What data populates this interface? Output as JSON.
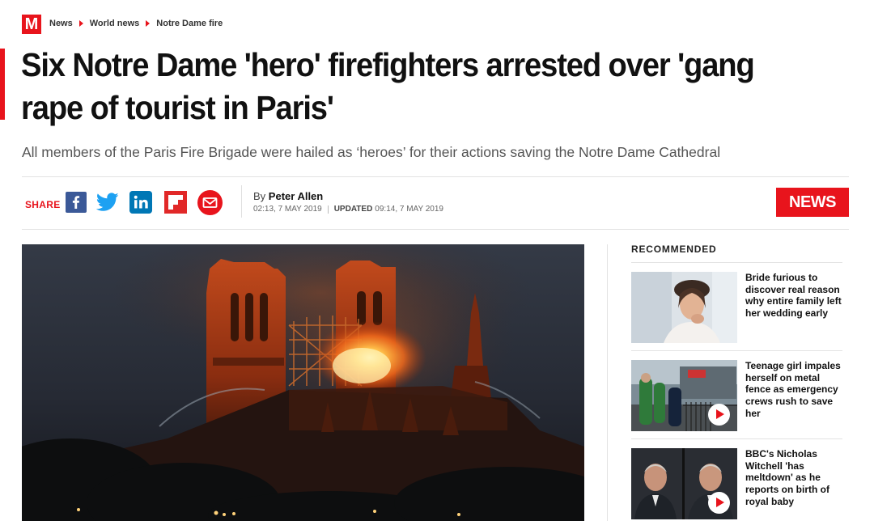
{
  "site": {
    "logo_letter": "M",
    "brand_color": "#e8141c"
  },
  "breadcrumb": [
    "News",
    "World news",
    "Notre Dame fire"
  ],
  "article": {
    "headline": "Six Notre Dame 'hero' firefighters arrested over 'gang rape of tourist in Paris'",
    "standfirst": "All members of the Paris Fire Brigade were hailed as ‘heroes’ for their actions saving the Notre Dame Cathedral",
    "by_prefix": "By",
    "author": "Peter Allen",
    "published": "02:13, 7 MAY 2019",
    "updated_label": "UPDATED",
    "updated": "09:14, 7 MAY 2019",
    "section_tag": "NEWS"
  },
  "share": {
    "label": "SHARE",
    "icons": [
      "facebook-icon",
      "twitter-icon",
      "linkedin-icon",
      "flipboard-icon",
      "email-icon"
    ]
  },
  "recommended": {
    "title": "RECOMMENDED",
    "items": [
      {
        "title": "Bride furious to discover real reason why entire family left her wedding early",
        "video": false
      },
      {
        "title": "Teenage girl impales herself on metal fence as emergency crews rush to save her",
        "video": true
      },
      {
        "title": "BBC's Nicholas Witchell 'has meltdown' as he reports on birth of royal baby",
        "video": true
      }
    ]
  }
}
